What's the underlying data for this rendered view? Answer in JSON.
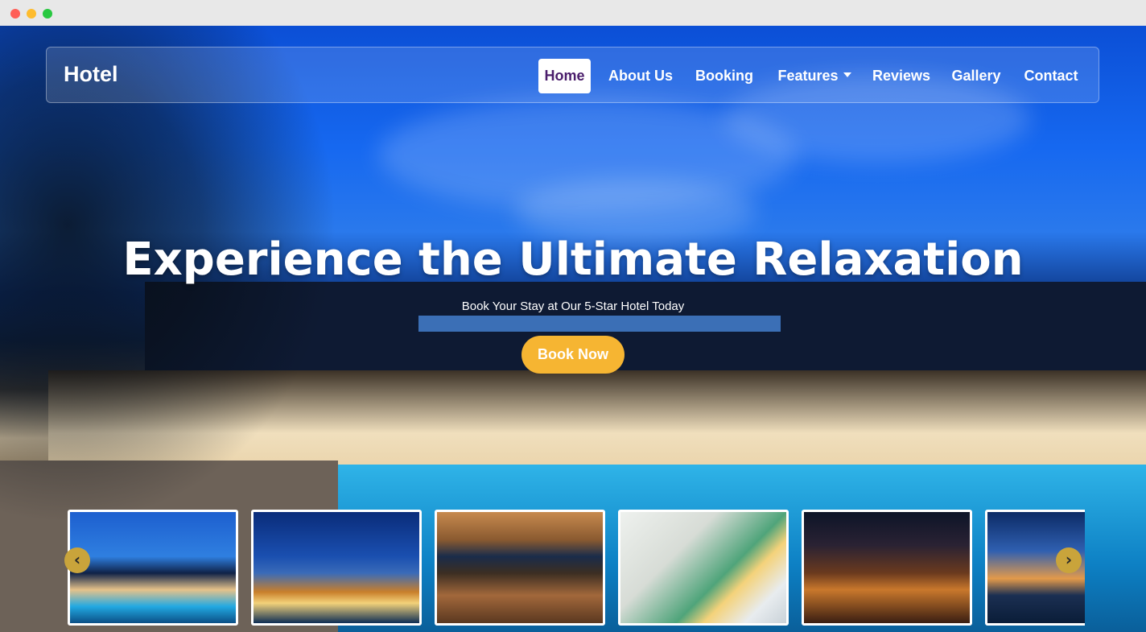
{
  "nav": {
    "brand": "Hotel",
    "items": [
      {
        "label": "Home",
        "active": true
      },
      {
        "label": "About Us"
      },
      {
        "label": "Booking"
      },
      {
        "label": "Features",
        "dropdown": true
      },
      {
        "label": "Reviews"
      },
      {
        "label": "Gallery"
      },
      {
        "label": "Contact"
      }
    ]
  },
  "hero": {
    "headline": "Experience the Ultimate Relaxation",
    "subheadline": "Book Your Stay at Our 5-Star Hotel Today",
    "cta_label": "Book Now"
  },
  "carousel": {
    "prev_icon": "chevron-left-icon",
    "next_icon": "chevron-right-icon",
    "prev_symbol": "‹",
    "next_symbol": "›",
    "thumbnails": [
      "pool-night-thumbnail",
      "palm-trees-thumbnail",
      "lounge-cabana-thumbnail",
      "breakfast-bed-thumbnail",
      "terrace-dining-thumbnail",
      "sunset-palms-thumbnail"
    ]
  },
  "colors": {
    "accent": "#f6b532",
    "active_nav_text": "#4a1d6b",
    "arrow": "#c9a43b"
  }
}
